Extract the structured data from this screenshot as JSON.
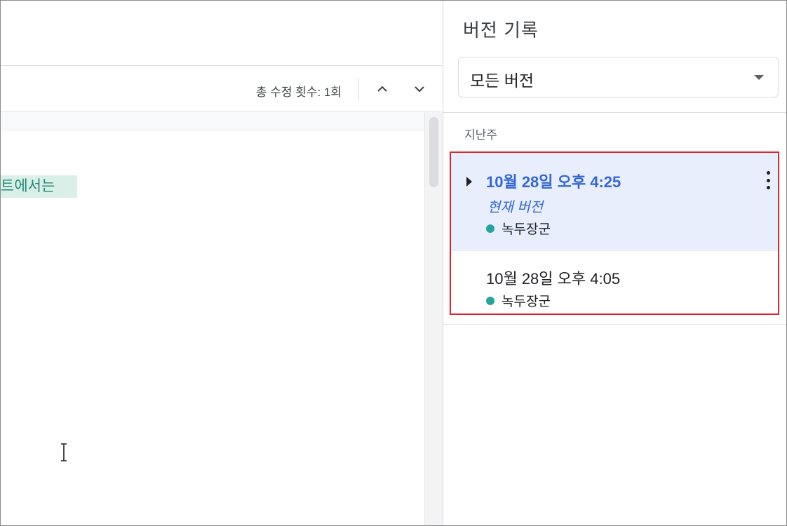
{
  "editor": {
    "edit_count": "총 수정 횟수: 1회",
    "highlighted_text": "트에서는",
    "highlight_color": "#d9efe8",
    "highlight_text_color": "#1e8a73"
  },
  "panel": {
    "title": "버전 기록",
    "filter": {
      "selected": "모든 버전"
    },
    "group_label": "지난주",
    "versions": [
      {
        "date": "10월 28일 오후 4:25",
        "label": "현재 버전",
        "author": "녹두장군",
        "author_color": "#26a69a",
        "selected": true
      },
      {
        "date": "10월 28일 오후 4:05",
        "author": "녹두장군",
        "author_color": "#26a69a",
        "selected": false
      }
    ]
  },
  "colors": {
    "accent": "#3367d6",
    "selected_row_bg": "#e8eefc",
    "annotation_box": "#e0242c"
  },
  "icons": {
    "prev_change": "chevron-up-icon",
    "next_change": "chevron-down-icon",
    "filter_dropdown": "caret-down-icon",
    "expand_version": "caret-right-icon",
    "version_menu": "more-vert-icon",
    "mouse_cursor": "text-cursor-icon"
  }
}
